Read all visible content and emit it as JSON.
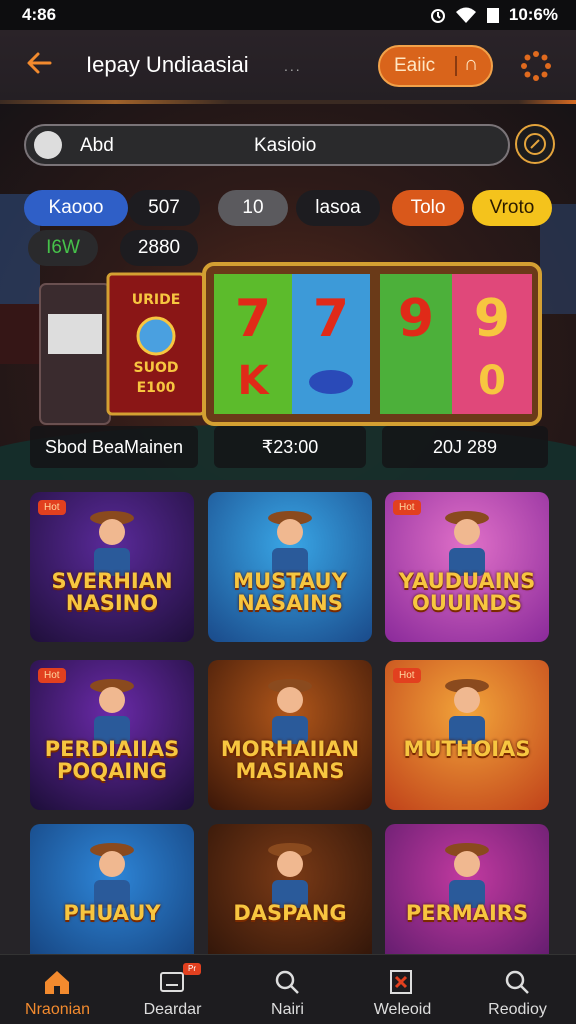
{
  "status": {
    "time": "4:86",
    "battery": "10:6%"
  },
  "header": {
    "title": "Iepay Undiaasiai",
    "title_suffix": "...",
    "balance_label": "Eaiic",
    "balance_arrow": "∩"
  },
  "search": {
    "left_text": "Abd",
    "right_text": "Kasioio"
  },
  "chips": [
    {
      "label": "Kaooo",
      "color": "#2f5fc7"
    },
    {
      "label": "507",
      "color": "#1d1c20"
    },
    {
      "label": "10",
      "color": "#5b5a5e"
    },
    {
      "label": "lasoa",
      "color": "#1d1c20"
    },
    {
      "label": "Tolo",
      "color": "#d9581b"
    },
    {
      "label": "Vroto",
      "color": "#f4c31c"
    },
    {
      "label": "I6W",
      "color": "#2a2a2c"
    },
    {
      "label": "2880",
      "color": "#1d1c20"
    }
  ],
  "machine": {
    "sign_line_1": "URIDE",
    "sign_line_2": "SUOD",
    "sign_line_3": "E100",
    "reel_symbols": [
      "7",
      "K",
      "7",
      "9",
      "9",
      "0"
    ]
  },
  "stats": {
    "left": "Sbod BeaMainen",
    "center": "₹23:00",
    "right": "20J 289"
  },
  "games": [
    {
      "badge": "Hot",
      "title": "SVERHIAN NASINO",
      "bg1": "#5a2a9a",
      "bg2": "#1f0f3a"
    },
    {
      "badge": "",
      "title": "MUSTAUY NASAINS",
      "bg1": "#39a6e6",
      "bg2": "#1a4a8a"
    },
    {
      "badge": "Hot",
      "title": "YAUDUAINS OUUINDS",
      "bg1": "#e070c8",
      "bg2": "#8a2a9a"
    },
    {
      "badge": "Hot",
      "title": "PERDIAIIAS POQAING",
      "bg1": "#6a2aa8",
      "bg2": "#1c0e38"
    },
    {
      "badge": "",
      "title": "MORHAIIAN MASIANS",
      "bg1": "#b0561a",
      "bg2": "#3a1608"
    },
    {
      "badge": "Hot",
      "title": "MUTHOIAS",
      "bg1": "#f2a43a",
      "bg2": "#c0421a"
    },
    {
      "badge": "",
      "title": "PHUAUY",
      "bg1": "#2e86d8",
      "bg2": "#143e78"
    },
    {
      "badge": "",
      "title": "DASPANG",
      "bg1": "#7a3a16",
      "bg2": "#2a1208"
    },
    {
      "badge": "",
      "title": "PERMAIRS",
      "bg1": "#c23aa0",
      "bg2": "#5a1a6a"
    }
  ],
  "nav": [
    {
      "label": "Nraonian",
      "icon": "home-icon",
      "active": true
    },
    {
      "label": "Deardar",
      "icon": "message-icon",
      "active": false,
      "badge": "Pr"
    },
    {
      "label": "Nairi",
      "icon": "search-icon",
      "active": false
    },
    {
      "label": "Weleoid",
      "icon": "cards-icon",
      "active": false
    },
    {
      "label": "Reodioy",
      "icon": "search-icon",
      "active": false
    }
  ],
  "colors": {
    "accent": "#f28a2e",
    "gold": "#f7c640",
    "background": "#1b1a1e"
  }
}
